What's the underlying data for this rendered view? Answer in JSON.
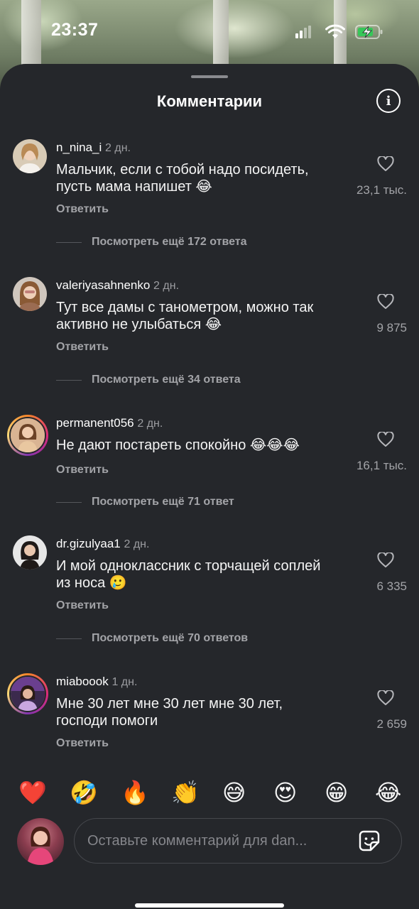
{
  "status_bar": {
    "time": "23:37"
  },
  "sheet": {
    "title": "Комментарии"
  },
  "comments": [
    {
      "username": "n_nina_i",
      "date": "2 дн.",
      "text_lines": [
        "Мальчик, если с тобой надо посидеть,",
        "пусть мама напишет 😂"
      ],
      "reply_label": "Ответить",
      "likes": "23,1 тыс.",
      "more_replies": "Посмотреть ещё 172 ответа"
    },
    {
      "username": "valeriyasahnenko",
      "date": "2 дн.",
      "text_lines": [
        "Тут все дамы с танометром, можно так",
        "активно не улыбаться 😂"
      ],
      "reply_label": "Ответить",
      "likes": "9 875",
      "more_replies": "Посмотреть ещё 34 ответа"
    },
    {
      "username": "permanent056",
      "date": "2 дн.",
      "text_lines": [
        "Не дают постареть спокойно 😂😂😂"
      ],
      "reply_label": "Ответить",
      "likes": "16,1 тыс.",
      "more_replies": "Посмотреть ещё 71 ответ"
    },
    {
      "username": "dr.gizulyaa1",
      "date": "2 дн.",
      "text_lines": [
        "И мой одноклассник с торчащей соплей",
        "из носа 🥲"
      ],
      "reply_label": "Ответить",
      "likes": "6 335",
      "more_replies": "Посмотреть ещё 70 ответов"
    },
    {
      "username": "miaboook",
      "date": "1 дн.",
      "text_lines": [
        "Мне 30 лет мне 30 лет мне 30 лет,",
        "господи помоги"
      ],
      "reply_label": "Ответить",
      "likes": "2 659"
    }
  ],
  "quick_reactions": [
    "❤️",
    "🤣",
    "🔥",
    "👏",
    "😅",
    "😍",
    "😁",
    "😂"
  ],
  "composer": {
    "placeholder": "Оставьте комментарий для dan..."
  },
  "colors": {
    "sheet_bg": "#25272b",
    "secondary_text": "#a3a4a8",
    "primary_text": "#f4f4f4"
  }
}
